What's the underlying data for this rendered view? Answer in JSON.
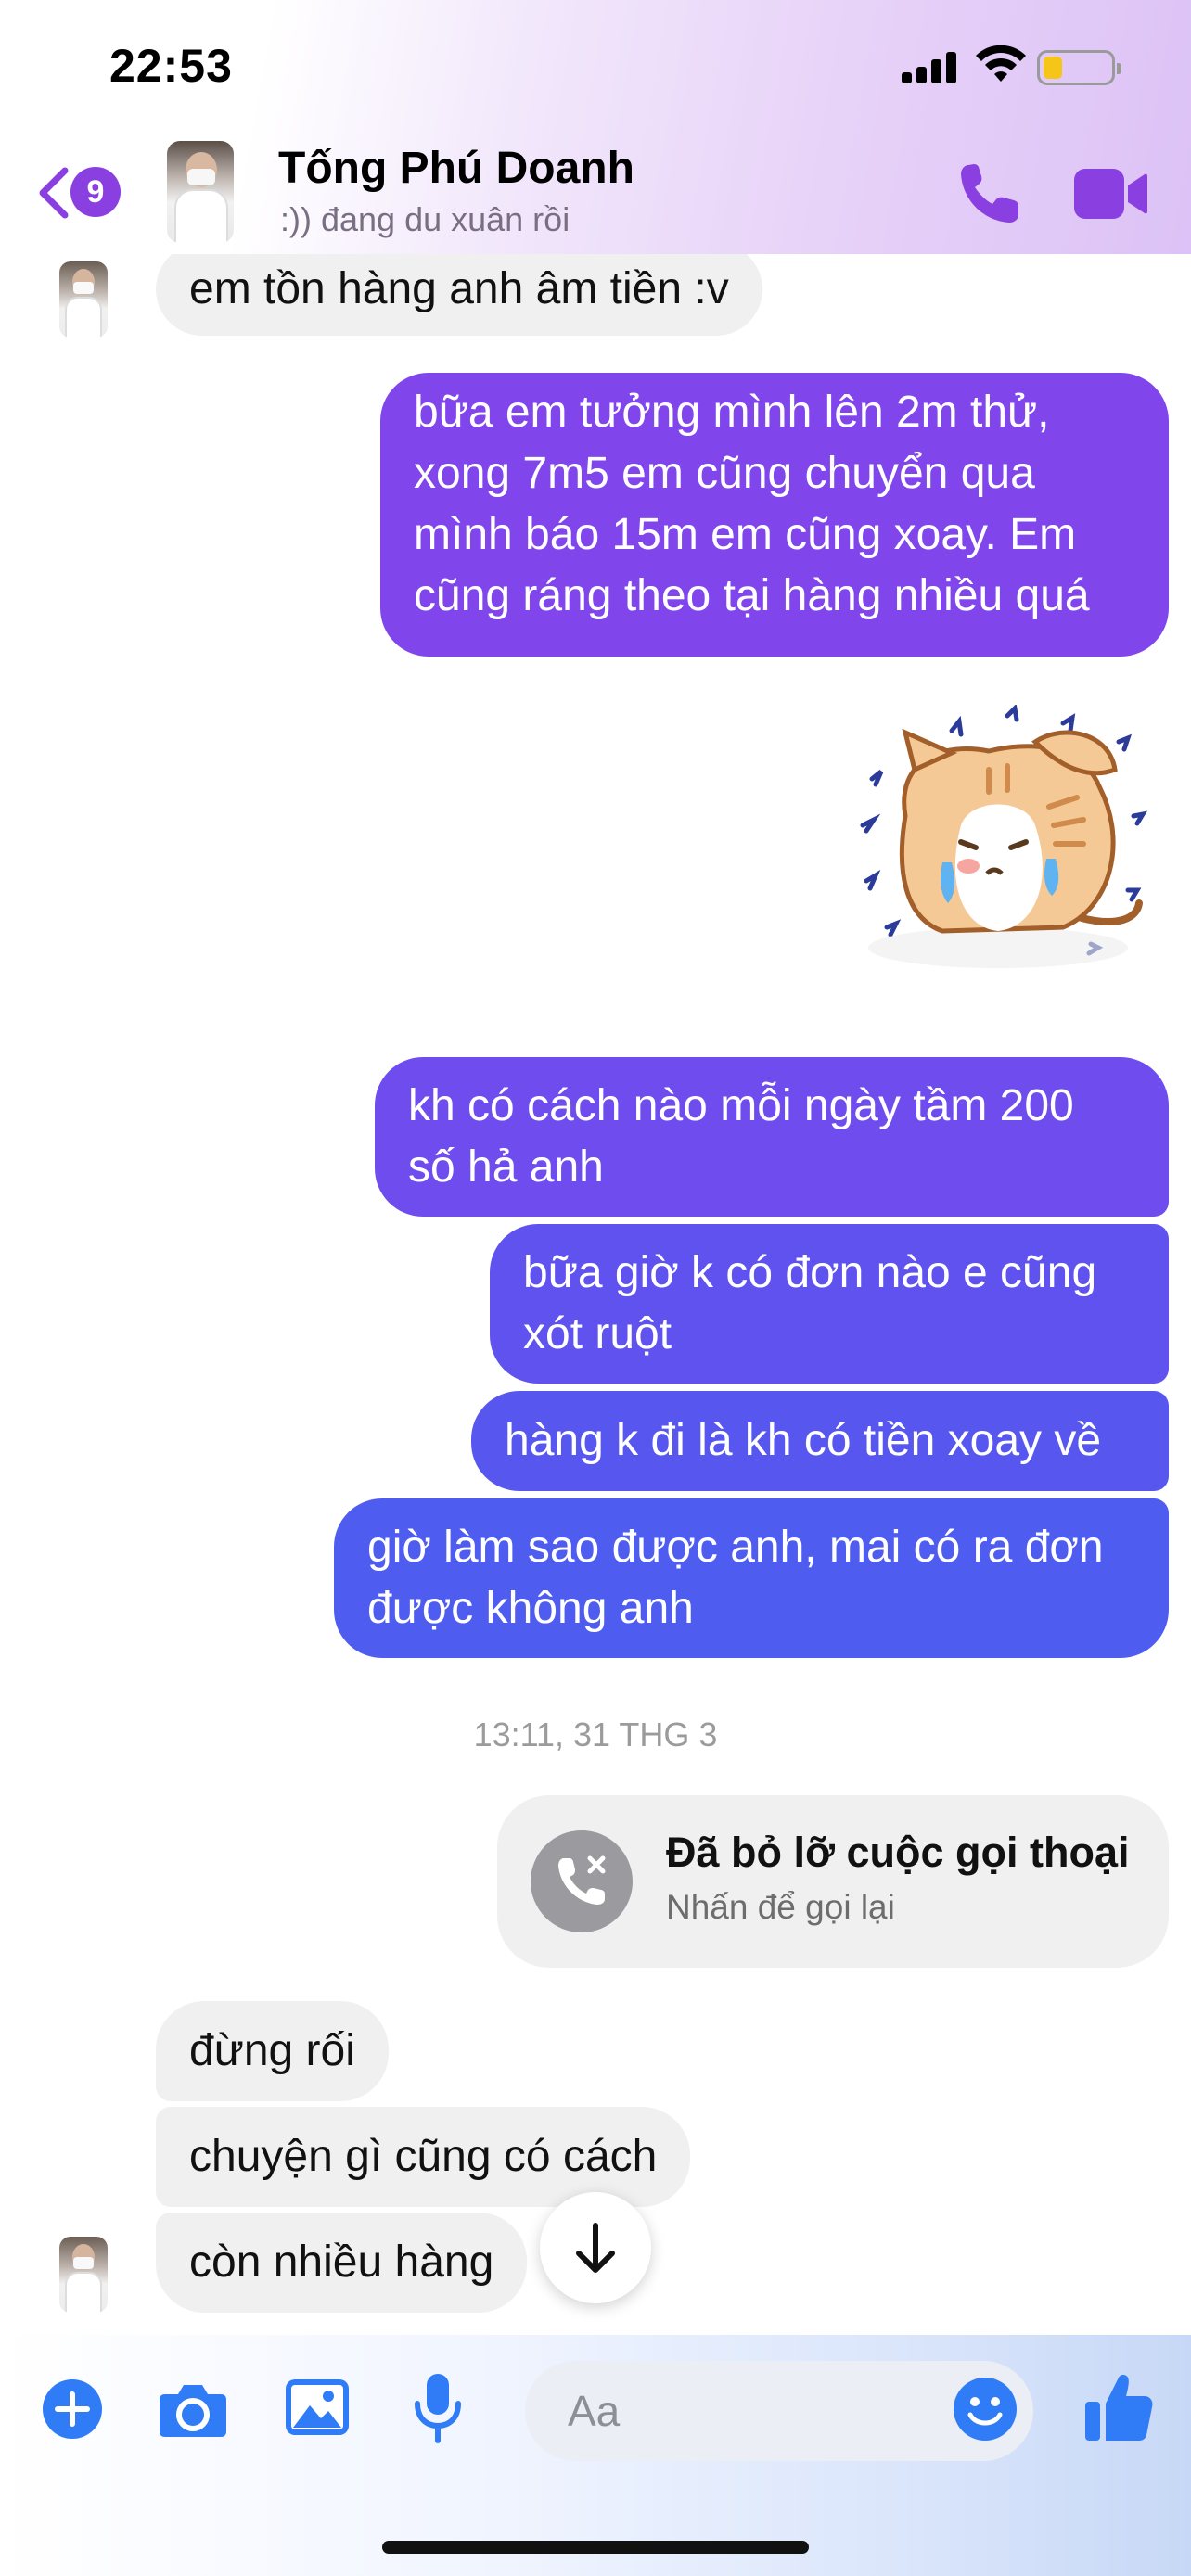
{
  "status_bar": {
    "time": "22:53"
  },
  "header": {
    "unread_count": "9",
    "contact_name": "Tống Phú Doanh",
    "contact_status": ":)) đang du xuân rồi"
  },
  "messages": {
    "m1": "em tồn hàng anh âm tiền :v",
    "m2": [
      "bữa em tưởng mình lên 2m thử,",
      "xong 7m5 em cũng chuyển qua",
      "mình báo 15m em cũng xoay. Em",
      "cũng ráng theo tại hàng nhiều quá"
    ],
    "m3": [
      "kh có cách nào mỗi ngày tầm 200",
      "số hả anh"
    ],
    "m4": [
      "bữa giờ k có đơn nào e cũng",
      "xót ruột"
    ],
    "m5": "hàng k đi là kh có tiền xoay về",
    "m6": [
      "giờ làm sao được anh, mai có ra đơn",
      "được không anh"
    ],
    "timestamp": "13:11, 31 THG 3",
    "missed_call": {
      "title": "Đã bỏ lỡ cuộc gọi thoại",
      "subtitle": "Nhấn để gọi lại"
    },
    "m7": "đừng rối",
    "m8": "chuyện gì cũng có cách",
    "m9": "còn nhiều hàng"
  },
  "composer": {
    "placeholder": "Aa"
  },
  "colors": {
    "accent": "#8a3fe0",
    "outgoing_top": "#8046ec",
    "outgoing_bottom": "#4f5cf0",
    "incoming": "#f0f0f0",
    "composer_icon": "#2f7cf6"
  },
  "icons": [
    "back-chevron-icon",
    "phone-icon",
    "video-camera-icon",
    "missed-call-icon",
    "arrow-down-icon",
    "plus-icon",
    "camera-icon",
    "image-icon",
    "microphone-icon",
    "emoji-icon",
    "thumbs-up-icon",
    "crying-cat-sticker"
  ]
}
